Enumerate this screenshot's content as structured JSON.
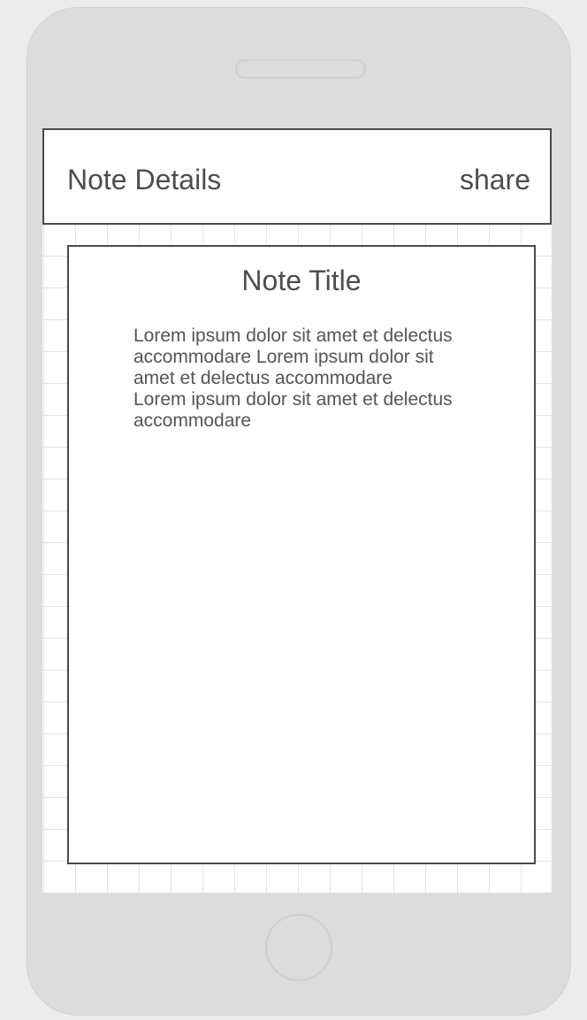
{
  "header": {
    "title": "Note Details",
    "share_label": "share"
  },
  "note": {
    "title": "Note Title",
    "paragraphs": [
      "Lorem ipsum dolor sit amet et delectus accommodare Lorem ipsum dolor sit amet et delectus accommodare",
      "Lorem ipsum dolor sit amet et delectus accommodare"
    ]
  },
  "colors": {
    "device_body": "#dcdcdc",
    "border": "#4a4a4a",
    "text": "#4d4d4d"
  }
}
